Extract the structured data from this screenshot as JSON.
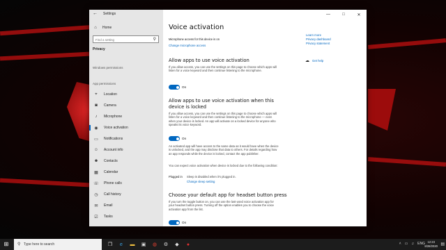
{
  "window": {
    "title": "Settings",
    "controls": [
      "—",
      "□",
      "✕"
    ]
  },
  "sidebar": {
    "home_label": "Home",
    "search_placeholder": "Find a setting",
    "section_title": "Privacy",
    "groups": [
      "Windows permissions",
      "App permissions"
    ],
    "items": [
      {
        "label": "Location",
        "icon": "location-icon"
      },
      {
        "label": "Camera",
        "icon": "camera-icon"
      },
      {
        "label": "Microphone",
        "icon": "microphone-icon"
      },
      {
        "label": "Voice activation",
        "icon": "voice-activation-icon",
        "selected": true
      },
      {
        "label": "Notifications",
        "icon": "notifications-icon"
      },
      {
        "label": "Account info",
        "icon": "account-info-icon"
      },
      {
        "label": "Contacts",
        "icon": "contacts-icon"
      },
      {
        "label": "Calendar",
        "icon": "calendar-icon"
      },
      {
        "label": "Phone calls",
        "icon": "phone-calls-icon"
      },
      {
        "label": "Call history",
        "icon": "call-history-icon"
      },
      {
        "label": "Email",
        "icon": "email-icon"
      },
      {
        "label": "Tasks",
        "icon": "tasks-icon"
      }
    ]
  },
  "content": {
    "title": "Voice activation",
    "mic_access_status": "Microphone access for this device is on",
    "change_mic_link": "Change microphone access",
    "section1": {
      "heading": "Allow apps to use voice activation",
      "description": "If you allow access, you can use the settings on this page to choose which apps will listen for a voice keyword and then continue listening to the microphone.",
      "toggle_label": "On"
    },
    "section2": {
      "heading": "Allow apps to use voice activation when this device is locked",
      "description": "If you allow access, you can use the settings on this page to choose which apps will listen for a voice keyword and then continue listening to the microphone — even when your device is locked. An app will activate on a locked device for anyone who speaks its voice keyword.",
      "toggle_label": "On",
      "note": "An activated app will have access to the same data as it would have when the device is unlocked, and the app may disclose that data to others. For details regarding how an app responds while the device is locked, contact the app publisher.",
      "expect_text": "You can expect voice activation when device is locked due to the following condition:",
      "plugged_in_label": "Plugged in",
      "plugged_in_value": "Sleep is disabled when it's plugged in.",
      "sleep_link": "Change sleep setting"
    },
    "section3": {
      "heading": "Choose your default app for headset button press",
      "description": "If you turn the toggle button on, you can use the last-used voice activation app for your headset button press. Turning off the option enables you to choose the voice activation app from the list.",
      "toggle_label": "On"
    },
    "right_links": [
      "Learn more",
      "Privacy dashboard",
      "Privacy statement"
    ],
    "help_label": "Get help"
  },
  "taskbar": {
    "search_text": "Type here to search",
    "tray_language": "ENG",
    "time": "12:23",
    "date": "8/28/2020"
  },
  "colors": {
    "accent": "#0067c0",
    "sidebar_bg": "#e6e6e6",
    "taskbar_bg": "#1c1c1c"
  }
}
